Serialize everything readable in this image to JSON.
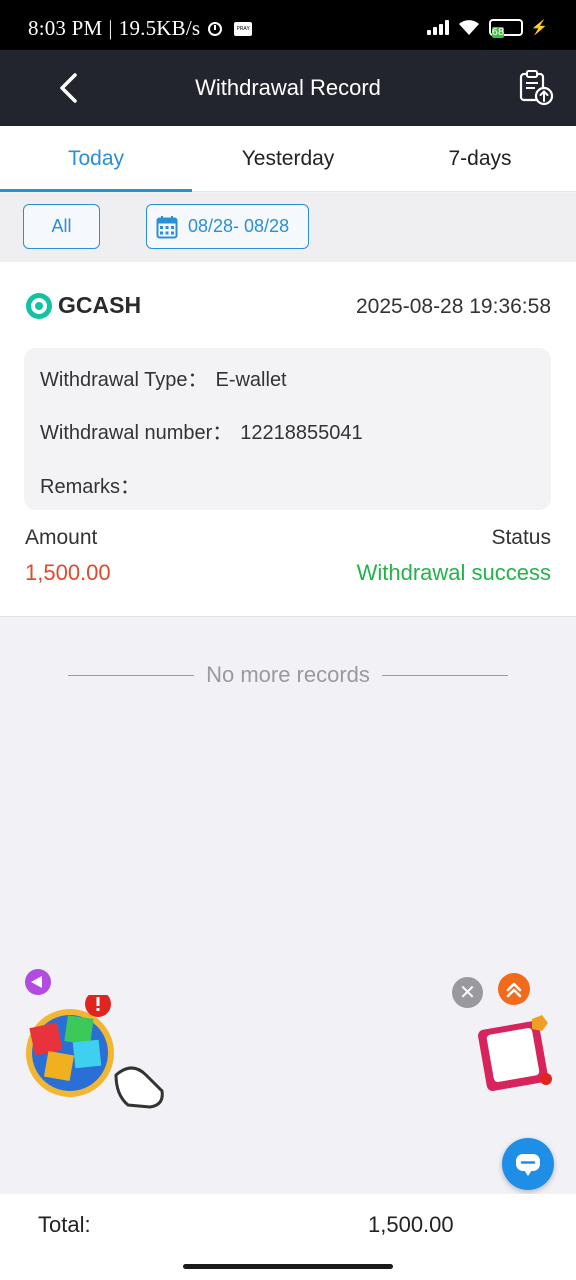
{
  "status_bar": {
    "time": "8:03 PM",
    "separator": "|",
    "speed": "19.5KB/s",
    "battery": "68",
    "pray_label": "PRAY"
  },
  "header": {
    "title": "Withdrawal Record"
  },
  "tabs": [
    {
      "label": "Today",
      "active": true
    },
    {
      "label": "Yesterday",
      "active": false
    },
    {
      "label": "7-days",
      "active": false
    }
  ],
  "filters": {
    "all_label": "All",
    "date_range": "08/28- 08/28"
  },
  "record": {
    "method": "GCASH",
    "datetime": "2025-08-28 19:36:58",
    "type_label": "Withdrawal Type：",
    "type_value": "E-wallet",
    "number_label": "Withdrawal number：",
    "number_value": "12218855041",
    "remarks_label": "Remarks：",
    "remarks_value": "",
    "amount_label": "Amount",
    "amount_value": "1,500.00",
    "status_label": "Status",
    "status_value": "Withdrawal success"
  },
  "list_end_text": "No more records",
  "footer": {
    "total_label": "Total:",
    "total_value": "1,500.00"
  },
  "colors": {
    "accent": "#2b8fd6",
    "header_bg": "#22252e",
    "amount": "#e04a2a",
    "success": "#22b34a",
    "chat": "#1f8ee6"
  }
}
